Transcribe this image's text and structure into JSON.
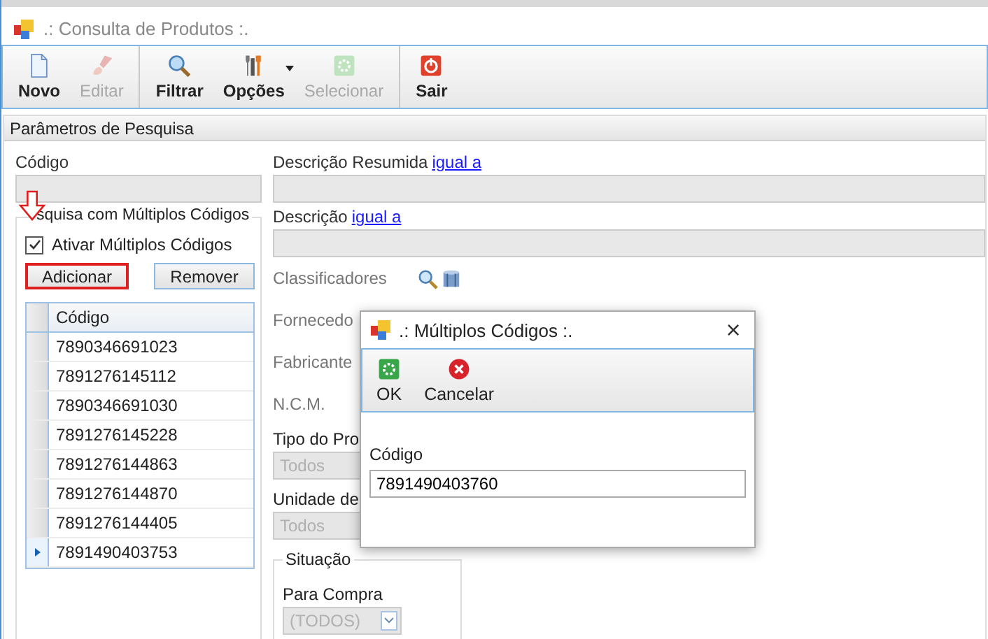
{
  "window": {
    "title": ".: Consulta de Produtos :."
  },
  "toolbar": [
    {
      "label": "Novo",
      "kind": "document",
      "disabled": false,
      "separator_before": false,
      "dropdown": false
    },
    {
      "label": "Editar",
      "kind": "brush",
      "disabled": true,
      "separator_before": false,
      "dropdown": false
    },
    {
      "label": "Filtrar",
      "kind": "magnifier",
      "disabled": false,
      "separator_before": true,
      "dropdown": false
    },
    {
      "label": "Opções",
      "kind": "tools",
      "disabled": false,
      "separator_before": false,
      "dropdown": true
    },
    {
      "label": "Selecionar",
      "kind": "gear",
      "disabled": true,
      "separator_before": false,
      "dropdown": false
    },
    {
      "label": "Sair",
      "kind": "power",
      "disabled": false,
      "separator_before": true,
      "dropdown": false
    }
  ],
  "panel": {
    "title": "Parâmetros de Pesquisa",
    "codigo": {
      "label": "Código"
    },
    "multi": {
      "group_label": "squisa com Múltiplos Códigos",
      "checkbox_label": "Ativar Múltiplos Códigos",
      "checked": true,
      "buttons": [
        {
          "label": "Adicionar",
          "highlighted": true
        },
        {
          "label": "Remover",
          "highlighted": false
        }
      ],
      "grid": {
        "column": "Código",
        "rows": [
          {
            "value": "7890346691023",
            "selected": false
          },
          {
            "value": "7891276145112",
            "selected": false
          },
          {
            "value": "7890346691030",
            "selected": false
          },
          {
            "value": "7891276145228",
            "selected": false
          },
          {
            "value": "7891276144863",
            "selected": false
          },
          {
            "value": "7891276144870",
            "selected": false
          },
          {
            "value": "7891276144405",
            "selected": false
          },
          {
            "value": "7891490403753",
            "selected": true
          }
        ]
      }
    },
    "descricao_resumida": {
      "label": "Descrição Resumida",
      "link": "igual a"
    },
    "descricao": {
      "label": "Descrição",
      "link": "igual a"
    },
    "filters": [
      {
        "label": "Classificadores",
        "kind": "lookup"
      },
      {
        "label": "Fornecedo",
        "kind": "plain"
      },
      {
        "label": "Fabricante",
        "kind": "plain"
      },
      {
        "label": "N.C.M.",
        "kind": "plain"
      }
    ],
    "tipo": {
      "label": "Tipo do Pro",
      "value": "Todos"
    },
    "unidade": {
      "label": "Unidade de",
      "value": "Todos"
    },
    "situacao": {
      "title": "Situação",
      "para_compra": {
        "label": "Para Compra",
        "value": "(TODOS)"
      }
    }
  },
  "dialog": {
    "title": ".: Múltiplos Códigos :.",
    "close": "×",
    "toolbar": [
      {
        "label": "OK",
        "kind": "ok"
      },
      {
        "label": "Cancelar",
        "kind": "cancel"
      }
    ],
    "field": {
      "label": "Código",
      "value": "7891490403760"
    }
  }
}
